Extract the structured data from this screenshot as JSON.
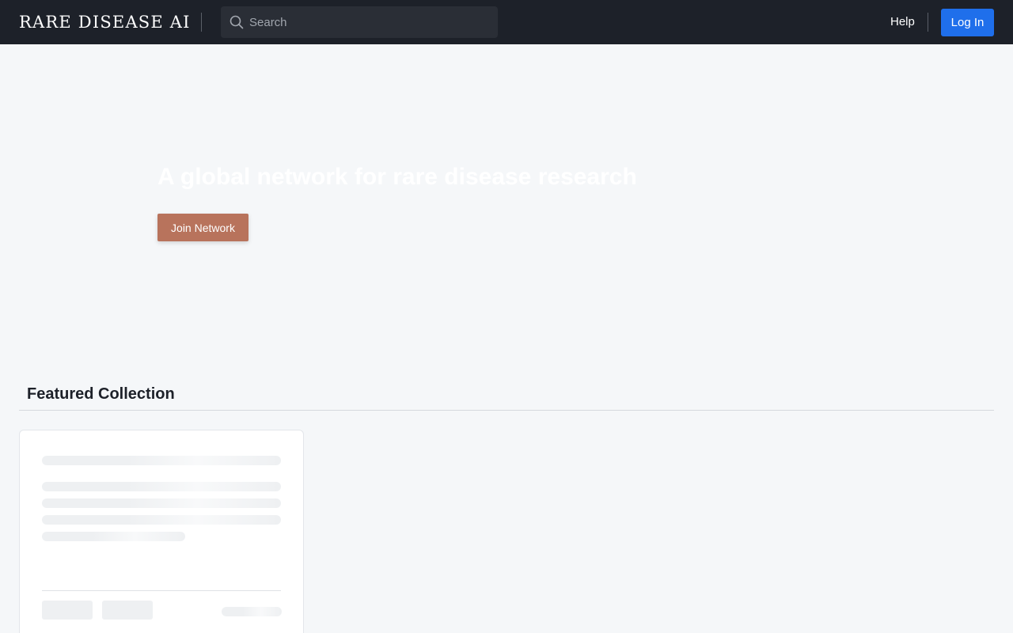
{
  "header": {
    "logo_text": "RARE DISEASE AI",
    "search_placeholder": "Search",
    "help_label": "Help",
    "login_label": "Log In",
    "bg_color": "#1d2129",
    "accent_color": "#1f6feb"
  },
  "hero": {
    "title": "A global network for rare disease research",
    "join_label": "Join Network",
    "join_color": "#b8735c"
  },
  "featured": {
    "title": "Featured Collection"
  },
  "icons": {
    "search": "search-icon"
  }
}
